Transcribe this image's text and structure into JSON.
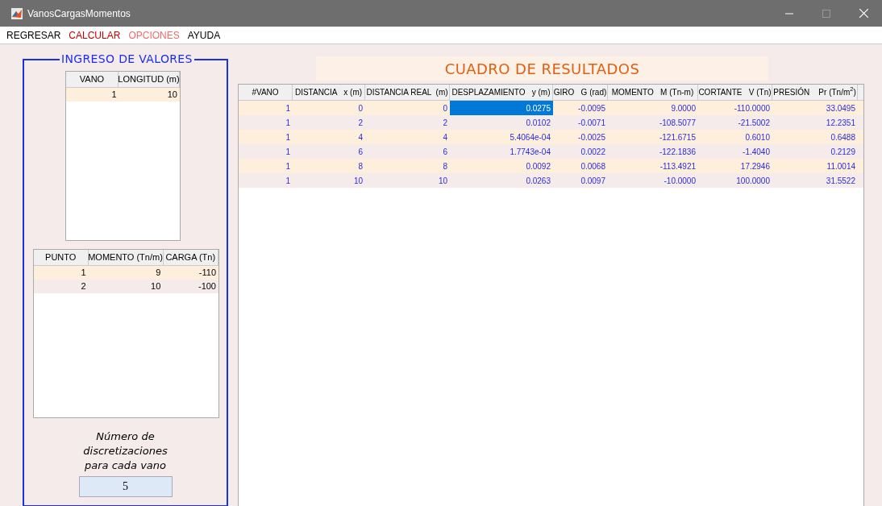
{
  "window": {
    "title": "VanosCargasMomentos"
  },
  "menu": [
    {
      "label": "REGRESAR",
      "color": "#000000"
    },
    {
      "label": "CALCULAR",
      "color": "#cc0000"
    },
    {
      "label": "OPCIONES",
      "color": "#f26b6b"
    },
    {
      "label": "AYUDA",
      "color": "#000000"
    }
  ],
  "input_panel": {
    "title": "INGRESO DE VALORES",
    "spans_table": {
      "columns": [
        "VANO",
        "LONGITUD (m)"
      ],
      "rows": [
        [
          "1",
          "10"
        ]
      ]
    },
    "points_table": {
      "columns": [
        "PUNTO",
        "MOMENTO (Tn/m)",
        "CARGA (Tn)"
      ],
      "rows": [
        [
          "1",
          "9",
          "-110"
        ],
        [
          "2",
          "10",
          "-100"
        ]
      ]
    },
    "discretization_label": "Número de discretizaciones para cada vano",
    "discretization_value": "5"
  },
  "results": {
    "title": "CUADRO DE RESULTADOS",
    "columns": [
      "#VANO",
      "DISTANCIA   x (m)",
      "DISTANCIA REAL  (m)",
      "DESPLAZAMIENTO   y (m)",
      "GIRO   G (rad)",
      "MOMENTO   M (Tn-m)",
      "CORTANTE   V (Tn)",
      "PRESIÓN    Pr (Tn/m$^{2}$)"
    ],
    "rows": [
      {
        "cells": [
          {
            "text": "1",
            "selected": false
          },
          {
            "text": "0",
            "selected": false
          },
          {
            "text": "0",
            "selected": false
          },
          {
            "text": "0.0275",
            "selected": true
          },
          {
            "text": "-0.0095",
            "selected": false
          },
          {
            "text": "9.0000",
            "selected": false
          },
          {
            "text": "-110.0000",
            "selected": false
          },
          {
            "text": "33.0495",
            "selected": false
          }
        ]
      },
      {
        "cells": [
          {
            "text": "1",
            "selected": false
          },
          {
            "text": "2",
            "selected": false
          },
          {
            "text": "2",
            "selected": false
          },
          {
            "text": "0.0102",
            "selected": false
          },
          {
            "text": "-0.0071",
            "selected": false
          },
          {
            "text": "-108.5077",
            "selected": false
          },
          {
            "text": "-21.5002",
            "selected": false
          },
          {
            "text": "12.2351",
            "selected": false
          }
        ]
      },
      {
        "cells": [
          {
            "text": "1",
            "selected": false
          },
          {
            "text": "4",
            "selected": false
          },
          {
            "text": "4",
            "selected": false
          },
          {
            "text": "5.4064e-04",
            "selected": false
          },
          {
            "text": "-0.0025",
            "selected": false
          },
          {
            "text": "-121.6715",
            "selected": false
          },
          {
            "text": "0.6010",
            "selected": false
          },
          {
            "text": "0.6488",
            "selected": false
          }
        ]
      },
      {
        "cells": [
          {
            "text": "1",
            "selected": false
          },
          {
            "text": "6",
            "selected": false
          },
          {
            "text": "6",
            "selected": false
          },
          {
            "text": "1.7743e-04",
            "selected": false
          },
          {
            "text": "0.0022",
            "selected": false
          },
          {
            "text": "-122.1836",
            "selected": false
          },
          {
            "text": "-1.4040",
            "selected": false
          },
          {
            "text": "0.2129",
            "selected": false
          }
        ]
      },
      {
        "cells": [
          {
            "text": "1",
            "selected": false
          },
          {
            "text": "8",
            "selected": false
          },
          {
            "text": "8",
            "selected": false
          },
          {
            "text": "0.0092",
            "selected": false
          },
          {
            "text": "0.0068",
            "selected": false
          },
          {
            "text": "-113.4921",
            "selected": false
          },
          {
            "text": "17.2946",
            "selected": false
          },
          {
            "text": "11.0014",
            "selected": false
          }
        ]
      },
      {
        "cells": [
          {
            "text": "1",
            "selected": false
          },
          {
            "text": "10",
            "selected": false
          },
          {
            "text": "10",
            "selected": false
          },
          {
            "text": "0.0263",
            "selected": false
          },
          {
            "text": "0.0097",
            "selected": false
          },
          {
            "text": "-10.0000",
            "selected": false
          },
          {
            "text": "100.0000",
            "selected": false
          },
          {
            "text": "31.5522",
            "selected": false
          }
        ]
      }
    ]
  }
}
